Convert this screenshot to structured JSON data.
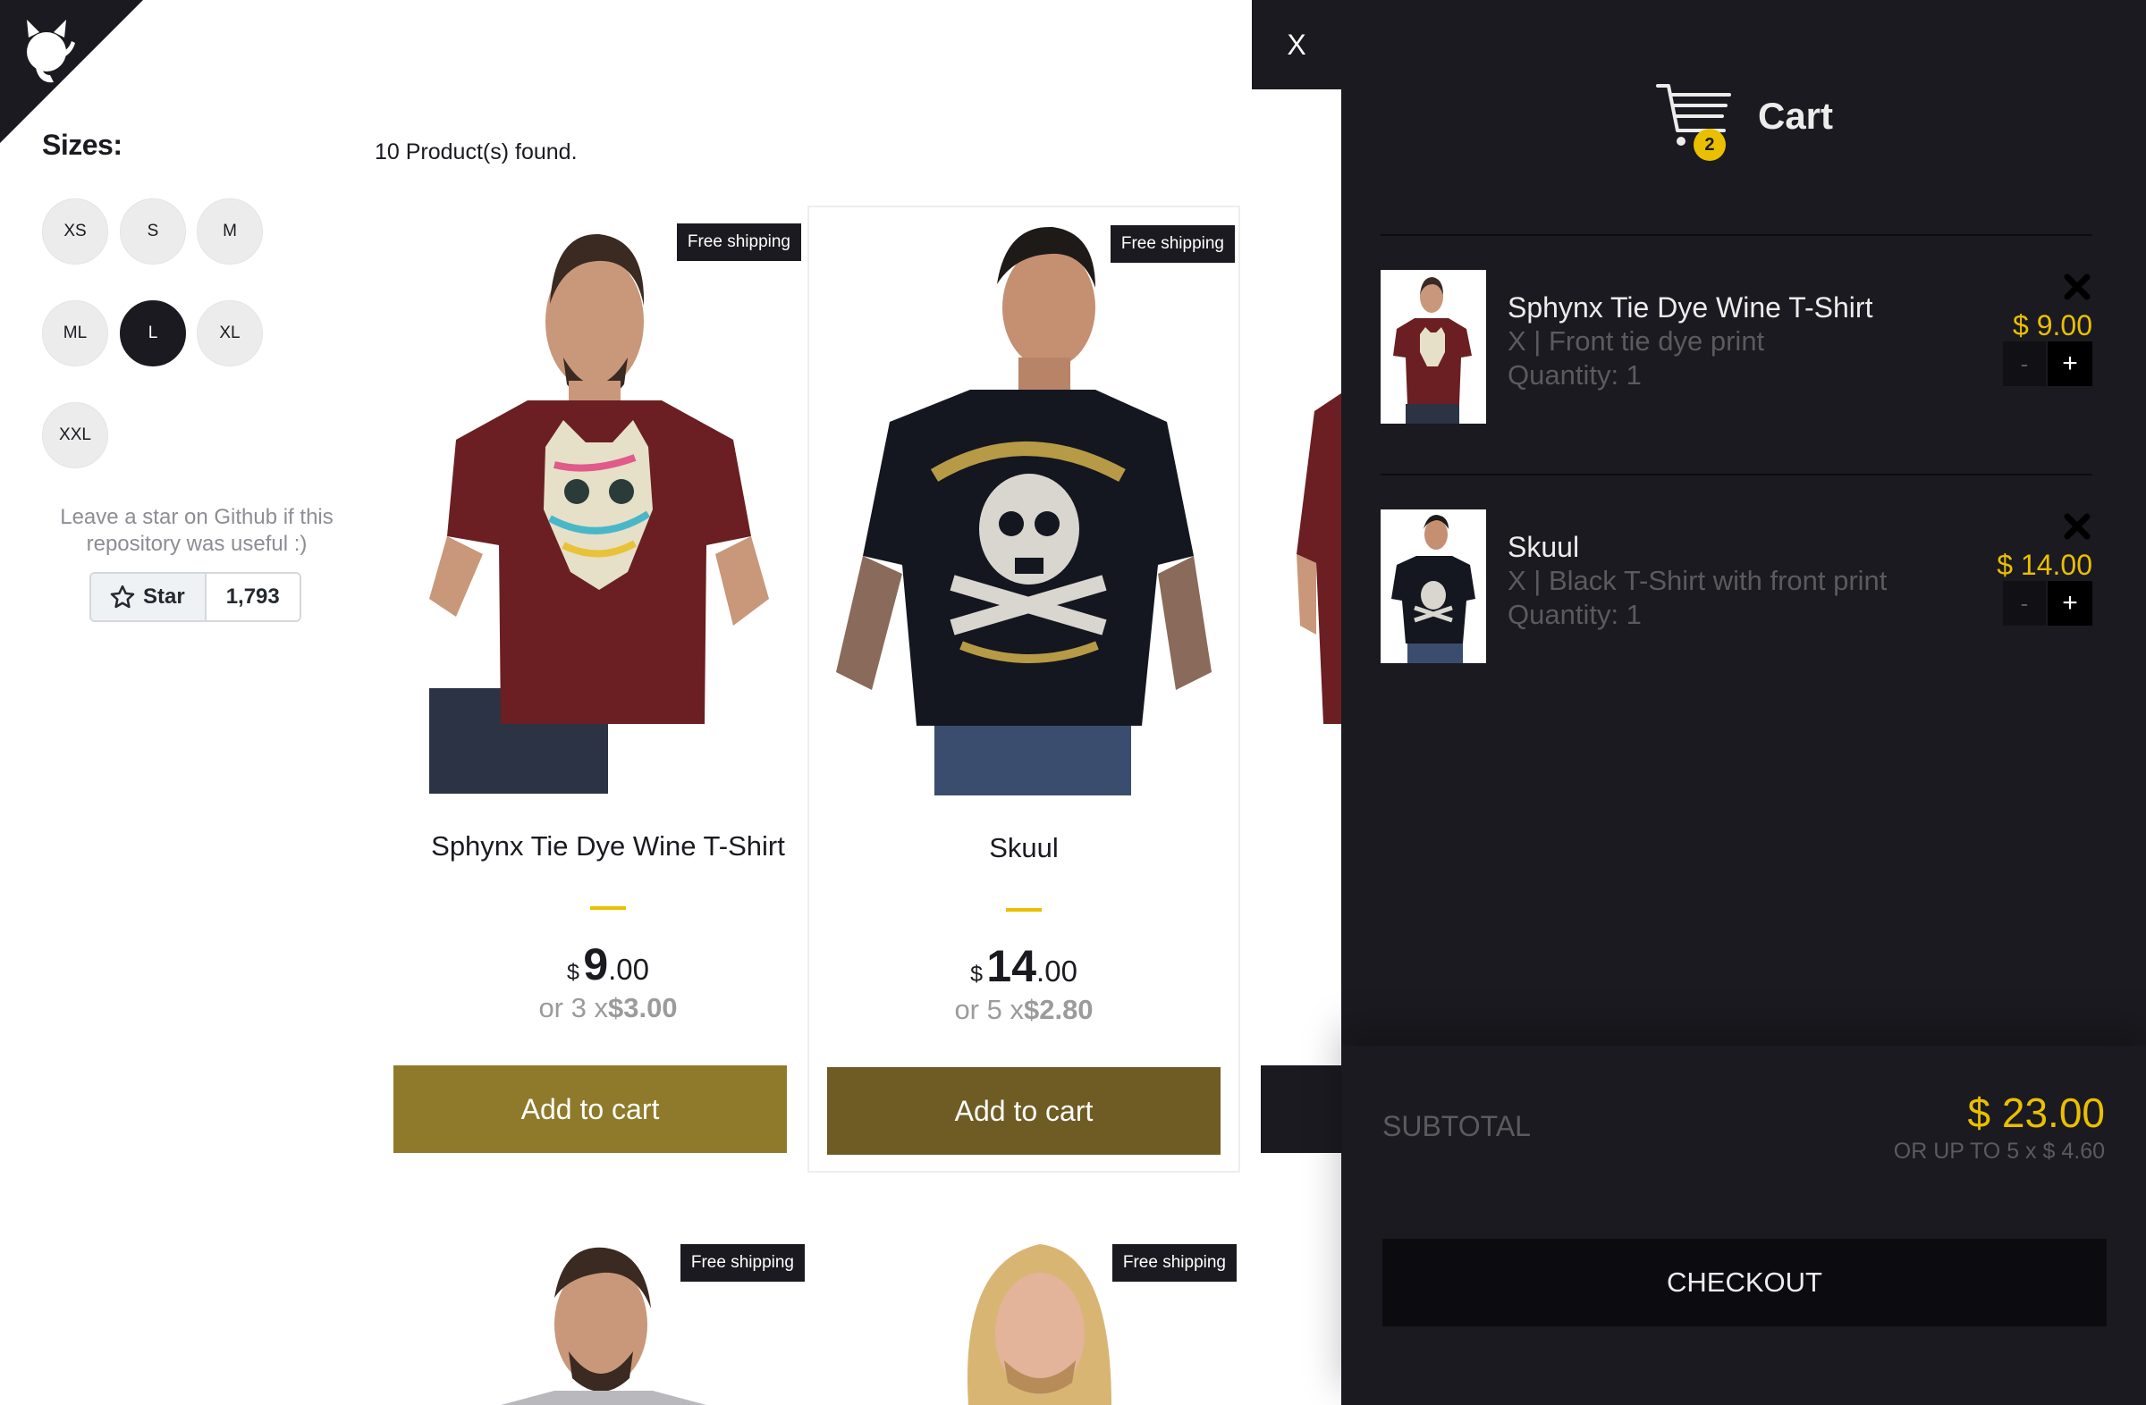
{
  "filters": {
    "title": "Sizes:",
    "sizes": [
      "XS",
      "S",
      "M",
      "ML",
      "L",
      "XL",
      "XXL"
    ],
    "selected": "L"
  },
  "github": {
    "note": "Leave a star on Github if this repository was useful :)",
    "star_label": "Star",
    "star_count": "1,793"
  },
  "shelf": {
    "found_text": "10 Product(s) found.",
    "products": [
      {
        "title": "Sphynx Tie Dye Wine T-Shirt",
        "badge": "Free shipping",
        "currency": "$",
        "price_int": "9",
        "price_cents": ".00",
        "installments_prefix": "or 3 x",
        "installment_value": "$3.00",
        "button": "Add to cart",
        "button_color": "#8e7a2a"
      },
      {
        "title": "Skuul",
        "badge": "Free shipping",
        "currency": "$",
        "price_int": "14",
        "price_cents": ".00",
        "installments_prefix": "or 5 x",
        "installment_value": "$2.80",
        "button": "Add to cart",
        "button_color": "#6e5c24"
      },
      {
        "badge": "Free shipping"
      },
      {
        "badge": "Free shipping"
      }
    ]
  },
  "cart": {
    "close_label": "X",
    "title": "Cart",
    "count": "2",
    "items": [
      {
        "title": "Sphynx Tie Dye Wine T-Shirt",
        "desc": "X | Front tie dye print",
        "quantity": "Quantity: 1",
        "price": "$ 9.00",
        "minus": "-",
        "plus": "+"
      },
      {
        "title": "Skuul",
        "desc": "X | Black T-Shirt with front print",
        "quantity": "Quantity: 1",
        "price": "$ 14.00",
        "minus": "-",
        "plus": "+"
      }
    ],
    "subtotal_label": "SUBTOTAL",
    "subtotal_value": "$ 23.00",
    "subtotal_installments": "OR UP TO 5 x $ 4.60",
    "checkout_label": "CHECKOUT"
  },
  "colors": {
    "accent": "#eabf00",
    "dark": "#1b1a20"
  }
}
